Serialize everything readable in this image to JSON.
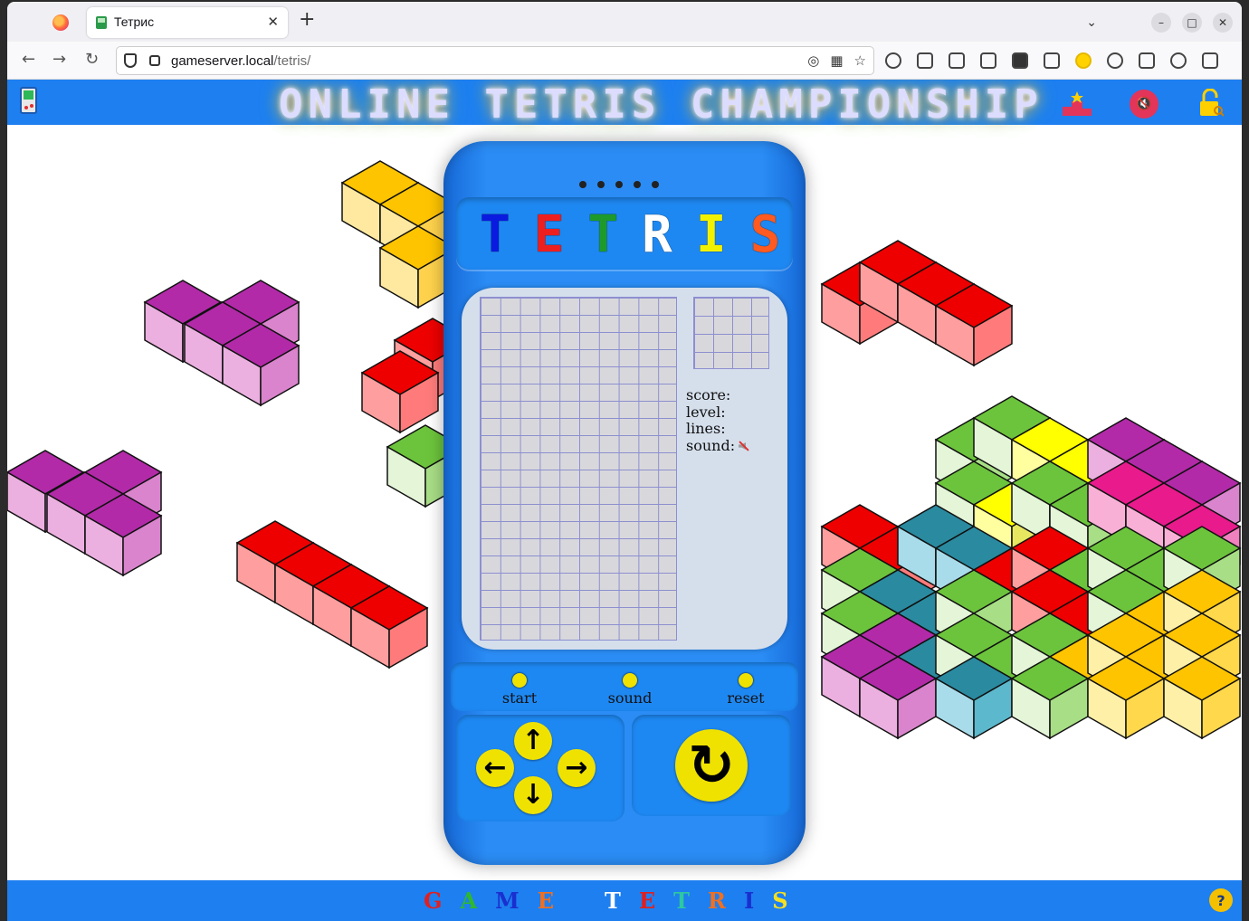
{
  "browser": {
    "tab_title": "Тетрис",
    "url_host": "gameserver.local",
    "url_path": "/tetris/",
    "new_tab_label": "+",
    "close_label": "✕"
  },
  "header": {
    "title": "ONLINE TETRIS CHAMPIONSHIP",
    "icons": [
      "gameboy-icon",
      "podium-icon",
      "sound-muted-icon",
      "lock-key-icon"
    ]
  },
  "device": {
    "logo_letters": [
      {
        "ch": "T",
        "color": "#0a1adf"
      },
      {
        "ch": "E",
        "color": "#ee1f1f"
      },
      {
        "ch": "T",
        "color": "#1e9a2a"
      },
      {
        "ch": "R",
        "color": "#ffffff"
      },
      {
        "ch": "I",
        "color": "#f2f200"
      },
      {
        "ch": "S",
        "color": "#ff5a1f"
      }
    ],
    "stats": {
      "score_label": "score:",
      "level_label": "level:",
      "lines_label": "lines:",
      "sound_label": "sound:"
    },
    "controls": {
      "start": "start",
      "sound": "sound",
      "reset": "reset"
    },
    "arrows": {
      "up": "↑",
      "left": "←",
      "right": "→",
      "down": "↓",
      "rotate": "↻"
    }
  },
  "footer": {
    "letters": [
      {
        "ch": "G",
        "color": "#e02020"
      },
      {
        "ch": "A",
        "color": "#2eb82e"
      },
      {
        "ch": "M",
        "color": "#1a2fd0"
      },
      {
        "ch": "E",
        "color": "#f07020"
      },
      {
        "ch": "T",
        "color": "#ffffff"
      },
      {
        "ch": "E",
        "color": "#e02020"
      },
      {
        "ch": "T",
        "color": "#2ec8a0"
      },
      {
        "ch": "R",
        "color": "#f07020"
      },
      {
        "ch": "I",
        "color": "#1a2fd0"
      },
      {
        "ch": "S",
        "color": "#f5e020"
      }
    ]
  },
  "colors": {
    "header_blue": "#1e7ff0",
    "device_blue": "#2a8cf4",
    "button_yellow": "#f0e200"
  }
}
